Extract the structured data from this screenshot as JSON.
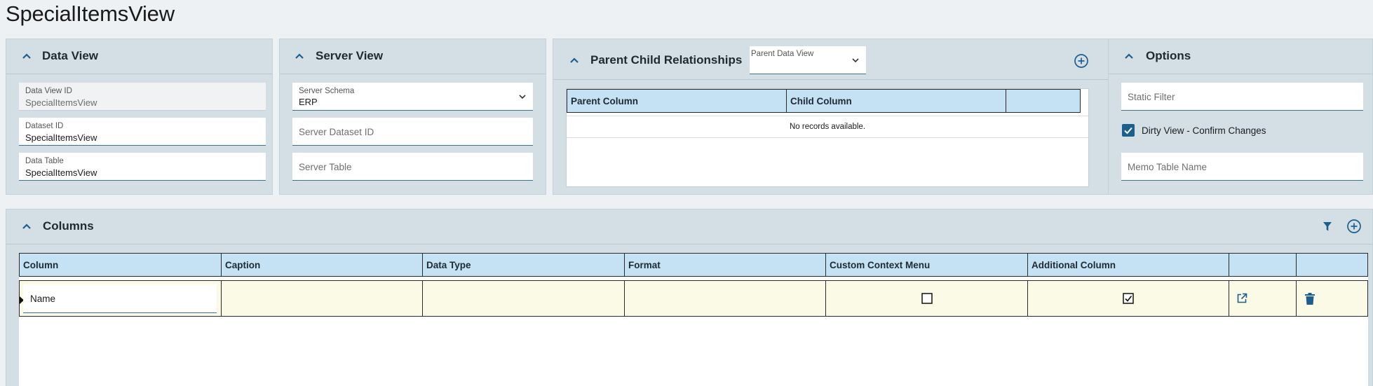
{
  "page": {
    "title": "SpecialItemsView"
  },
  "data_view": {
    "title": "Data View",
    "fields": [
      {
        "label": "Data View ID",
        "value": "SpecialItemsView",
        "disabled": true
      },
      {
        "label": "Dataset ID",
        "value": "SpecialItemsView"
      },
      {
        "label": "Data Table",
        "value": "SpecialItemsView"
      }
    ]
  },
  "server_view": {
    "title": "Server View",
    "schema": {
      "label": "Server Schema",
      "value": "ERP"
    },
    "dataset_placeholder": "Server Dataset ID",
    "table_placeholder": "Server Table"
  },
  "parent_child": {
    "title": "Parent Child Relationships",
    "dropdown_label": "Parent Data View",
    "columns": [
      "Parent Column",
      "Child Column",
      ""
    ],
    "empty_text": "No records available."
  },
  "options": {
    "title": "Options",
    "static_filter_placeholder": "Static Filter",
    "dirty_view_label": "Dirty View - Confirm Changes",
    "dirty_view_checked": true,
    "memo_table_placeholder": "Memo Table Name"
  },
  "columns_panel": {
    "title": "Columns",
    "headers": [
      "Column",
      "Caption",
      "Data Type",
      "Format",
      "Custom Context Menu",
      "Additional Column",
      "",
      ""
    ],
    "rows": [
      {
        "column": "Name",
        "caption": "",
        "data_type": "",
        "format": "",
        "custom_context_menu": false,
        "additional_column": true
      }
    ]
  },
  "icons": {
    "collapse": "chevron-up-icon",
    "add": "plus-circle-icon",
    "filter": "filter-icon",
    "open": "external-link-icon",
    "delete": "trash-icon",
    "row_indicator": "caret-right-icon"
  },
  "colors": {
    "panel_bg": "#d3dfe4",
    "header_bg": "#c5e2f4",
    "row_bg": "#fbfae6",
    "accent": "#1c5f8f"
  }
}
